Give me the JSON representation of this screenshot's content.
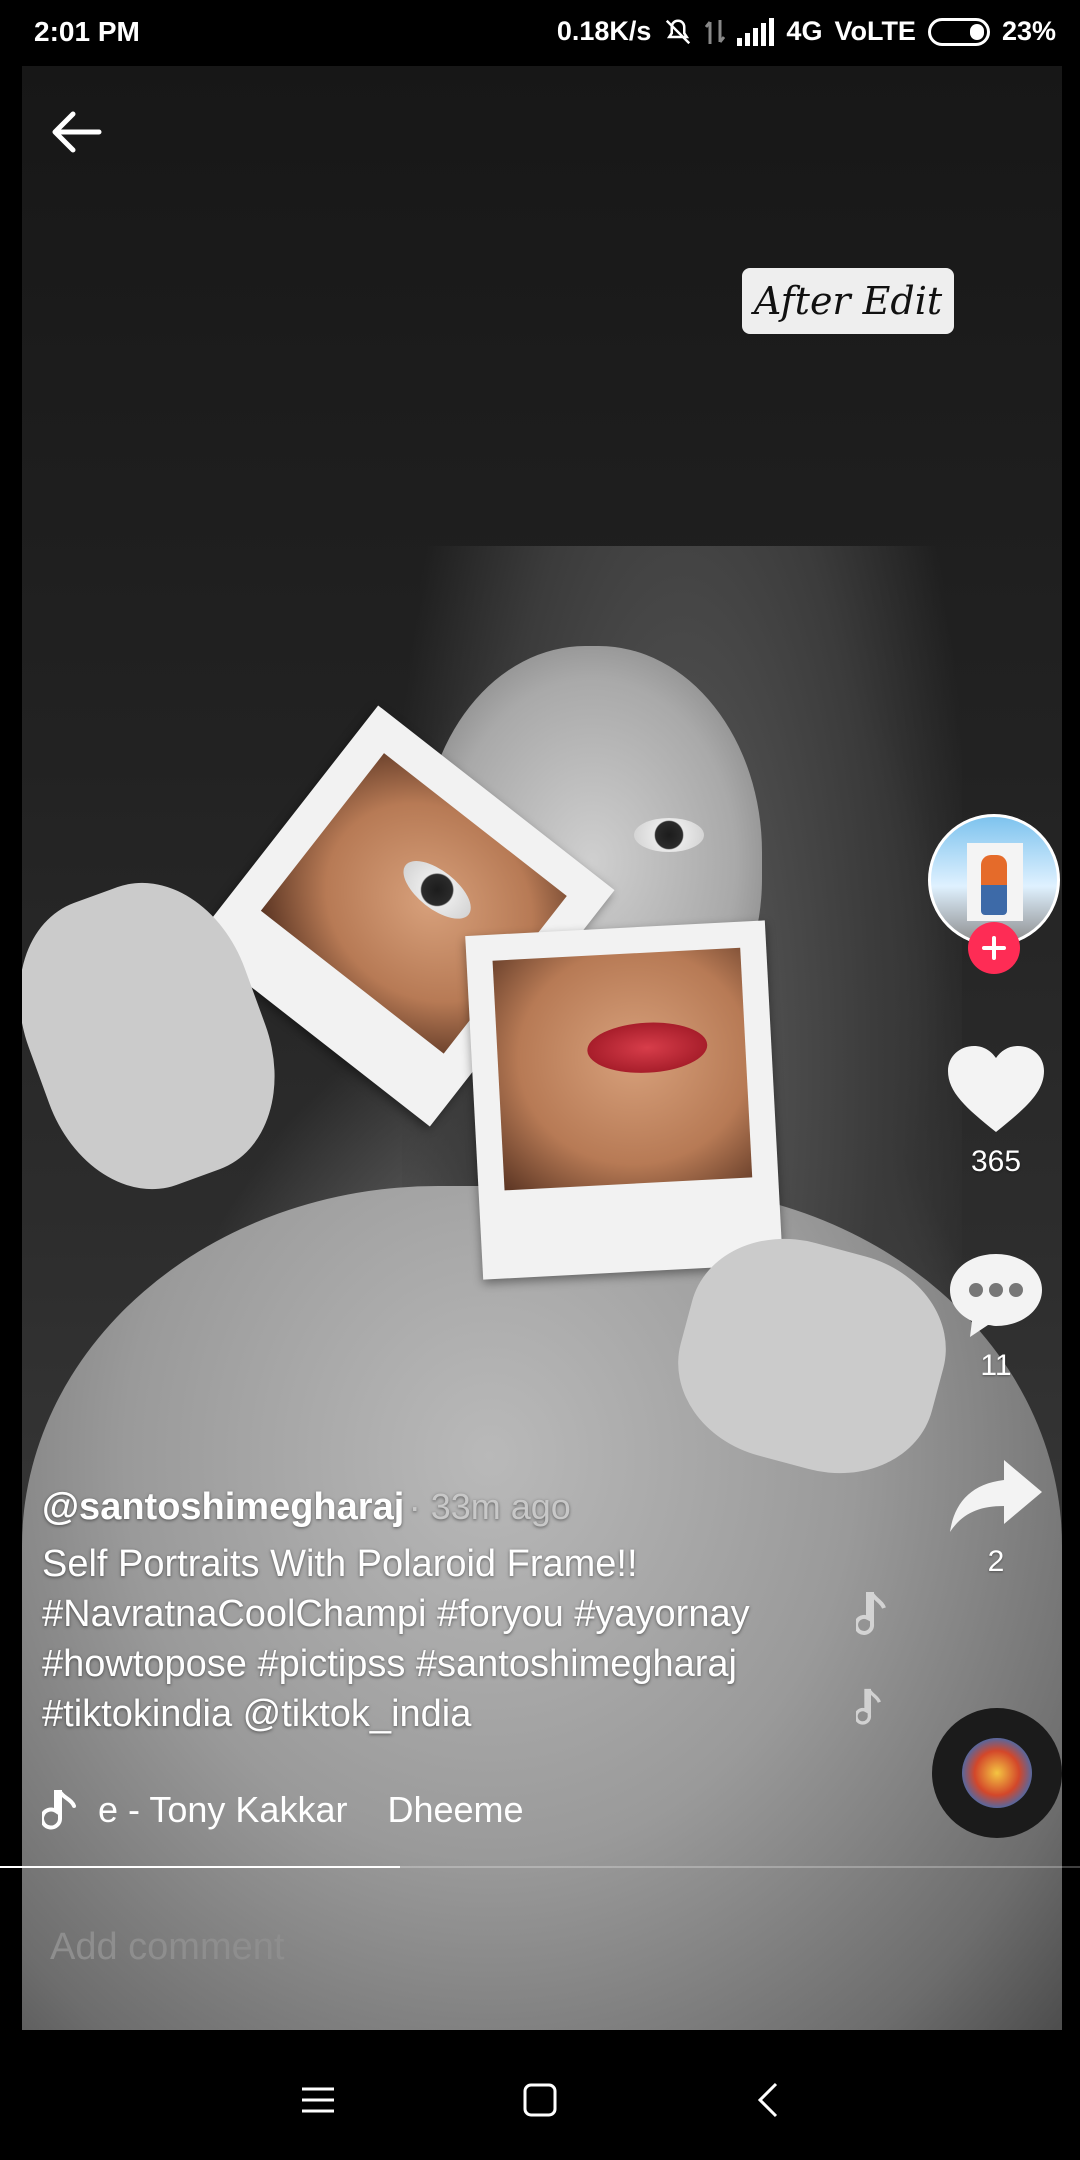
{
  "status_bar": {
    "time": "2:01 PM",
    "network_speed": "0.18K/s",
    "network_type": "4G",
    "volte": "VoLTE",
    "battery": "23%"
  },
  "video": {
    "overlay_label": "After Edit"
  },
  "side_actions": {
    "likes": "365",
    "comments": "11",
    "shares": "2"
  },
  "caption": {
    "username": "@santoshimegharaj",
    "time_ago": "· 33m ago",
    "line1": "Self Portraits With Polaroid Frame!!",
    "line2": "#NavratnaCoolChampi #foryou #yayornay",
    "line3": "#howtopose #pictipss #santoshimegharaj",
    "line4": "#tiktokindia @tiktok_india"
  },
  "music": {
    "text_a": "e - Tony Kakkar",
    "text_b": "Dheeme"
  },
  "comment": {
    "placeholder": "Add comment"
  },
  "progress": 0.37,
  "icons": {
    "back": "back-arrow-icon",
    "like": "heart-icon",
    "comment": "comment-icon",
    "share": "share-icon",
    "music": "music-note-icon",
    "follow": "plus-icon"
  },
  "colors": {
    "accent": "#fe2c55"
  }
}
